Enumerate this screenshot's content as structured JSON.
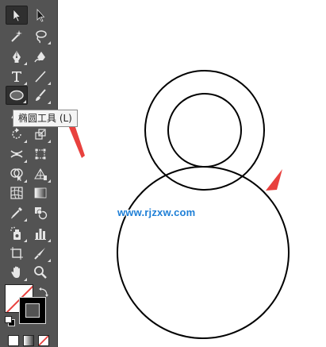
{
  "tooltip": {
    "text": "椭圆工具 (L)"
  },
  "watermark": {
    "text": "www.rjzxw.com"
  },
  "colors": {
    "toolbar_bg": "#535353",
    "canvas_bg": "#ffffff",
    "annotation_arrow": "#e8413e",
    "watermark": "#1e7fd6",
    "fill_swatch": "#ffffff",
    "stroke_swatch": "#000000",
    "no_color_slash": "#e8413e"
  },
  "tools": [
    "selection-tool",
    "direct-selection-tool",
    "magic-wand-tool",
    "lasso-tool",
    "pen-tool",
    "curvature-pen-tool",
    "type-tool",
    "line-segment-tool",
    "ellipse-tool",
    "paintbrush-tool",
    "shaper-tool",
    "eraser-tool",
    "rotate-tool",
    "scale-tool",
    "width-tool",
    "free-transform-tool",
    "shape-builder-tool",
    "perspective-grid-tool",
    "mesh-tool",
    "gradient-tool",
    "eyedropper-tool",
    "blend-tool",
    "symbol-sprayer-tool",
    "column-graph-tool",
    "artboard-tool",
    "slice-tool",
    "hand-tool",
    "zoom-tool"
  ]
}
